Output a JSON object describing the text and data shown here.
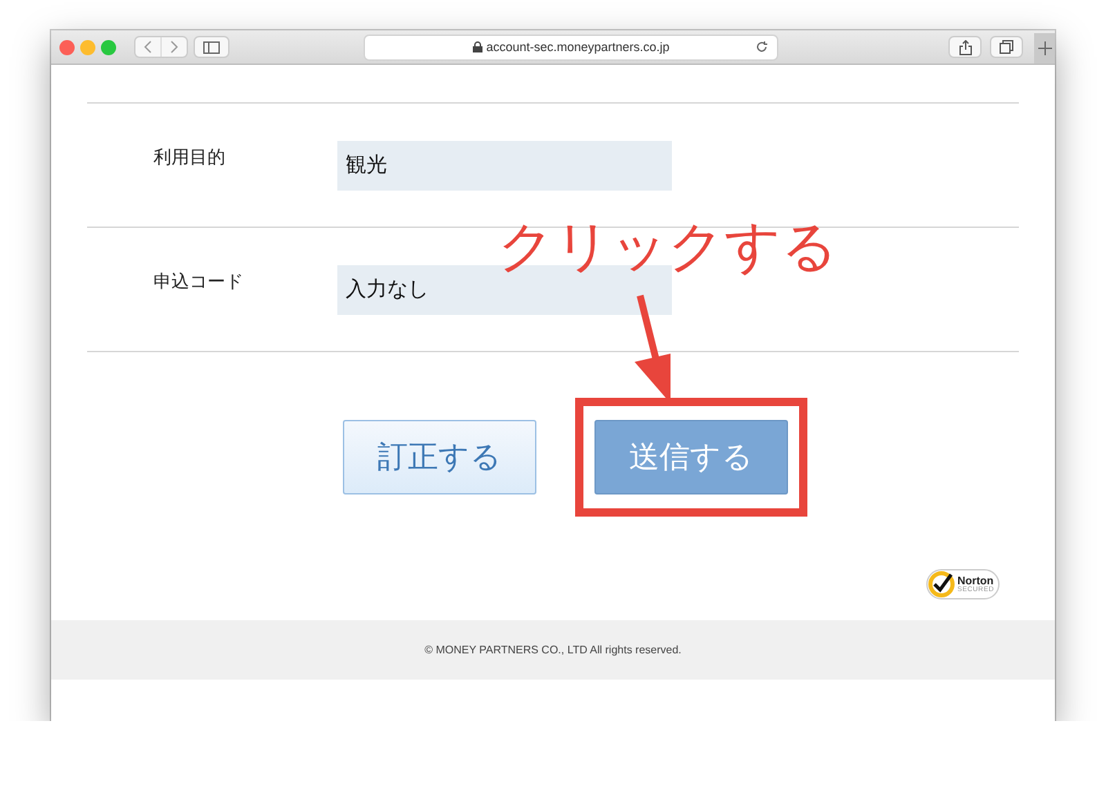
{
  "window": {
    "url": "account-sec.moneypartners.co.jp"
  },
  "rows": [
    {
      "label": "利用目的",
      "value": "観光"
    },
    {
      "label": "申込コード",
      "value": "入力なし"
    }
  ],
  "buttons": [
    {
      "kind": "secondary",
      "label": "訂正する",
      "highlighted": false
    },
    {
      "kind": "primary",
      "label": "送信する",
      "highlighted": true
    }
  ],
  "annotation": {
    "text": "クリックする"
  },
  "badge": {
    "brand": "Norton",
    "caption": "SECURED"
  },
  "footer": {
    "copyright": "© MONEY PARTNERS CO., LTD All rights reserved."
  }
}
